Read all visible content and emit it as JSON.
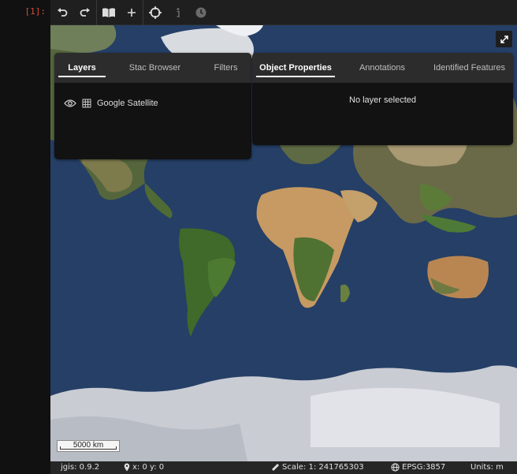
{
  "cell": {
    "prompt": "[1]:"
  },
  "toolbar": {
    "buttons": [
      {
        "name": "undo-button",
        "icon": "undo-icon"
      },
      {
        "name": "redo-button",
        "icon": "redo-icon"
      },
      {
        "name": "open-book-button",
        "icon": "book-icon"
      },
      {
        "name": "add-button",
        "icon": "plus-icon"
      },
      {
        "name": "center-button",
        "icon": "crosshair-icon"
      },
      {
        "name": "info-button",
        "icon": "info-icon"
      },
      {
        "name": "history-button",
        "icon": "clock-icon"
      }
    ]
  },
  "left_panel": {
    "tabs": [
      "Layers",
      "Stac Browser",
      "Filters"
    ],
    "active_tab": "Layers",
    "layers": [
      {
        "name": "Google Satellite",
        "visible": true
      }
    ]
  },
  "right_panel": {
    "tabs": [
      "Object Properties",
      "Annotations",
      "Identified Features"
    ],
    "active_tab": "Object Properties",
    "empty_message": "No layer selected"
  },
  "map": {
    "scale_bar": "5000 km"
  },
  "status": {
    "version": "jgis: 0.9.2",
    "coords": "x: 0 y: 0",
    "scale": "Scale: 1: 241765303",
    "projection": "EPSG:3857",
    "units": "Units: m"
  },
  "colors": {
    "prompt": "#d84a3c",
    "ocean": "#24426b",
    "panel": "#121212",
    "tabbar": "#2c2c2c"
  }
}
